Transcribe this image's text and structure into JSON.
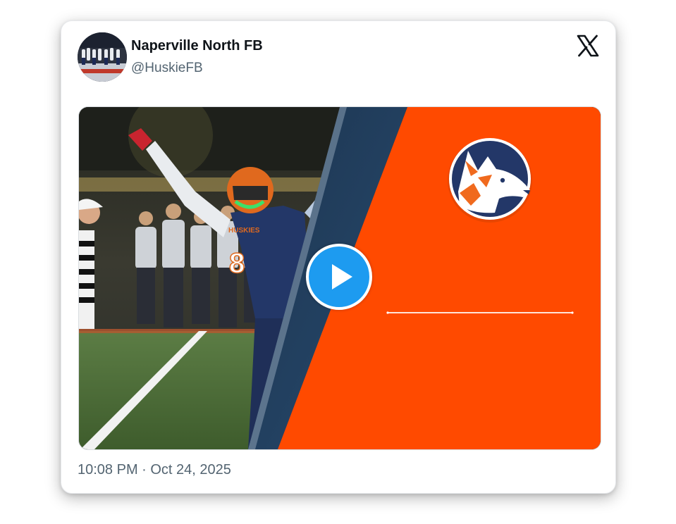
{
  "tweet": {
    "author_name": "Naperville North FB",
    "author_handle": "@HuskieFB",
    "timestamp": "10:08 PM · Oct 24, 2025",
    "platform_icon": "x-logo-icon",
    "avatar_icon": "team-photo-avatar"
  },
  "media": {
    "type": "video",
    "play_icon": "play-icon",
    "player_jersey_number": "8",
    "jersey_text": "HUSKIES",
    "logo_icon": "husky-mascot-logo",
    "accent_color": "#ff4a00",
    "navy_color": "#233768"
  },
  "colors": {
    "play_button": "#1d9bf0",
    "text_primary": "#0f1419",
    "text_secondary": "#536471"
  }
}
